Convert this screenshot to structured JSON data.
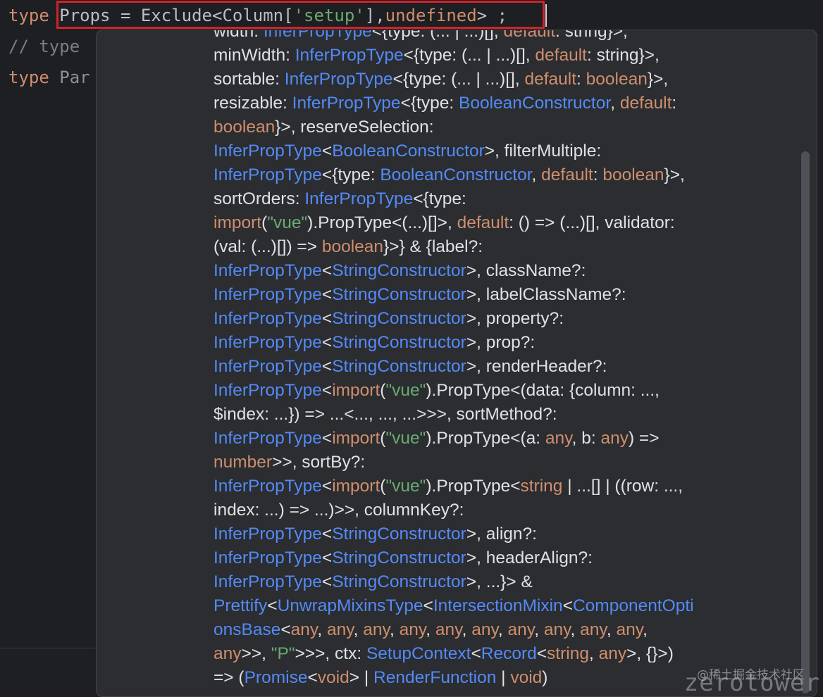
{
  "editor": {
    "line1": {
      "kw": "type",
      "rest_a": "Props = Exclude<Column[",
      "str": "'setup'",
      "rest_b": "],",
      "kw2": "undefined",
      "rest_c": "> ;"
    },
    "line2": {
      "comment": "// type"
    },
    "line3": {
      "kw": "type",
      "rest": "Par"
    }
  },
  "popup": {
    "lines": [
      [
        [
          "t",
          "width: "
        ],
        [
          "ty",
          "InferPropType"
        ],
        [
          "t",
          "<{type: (... | ...)[], "
        ],
        [
          "or",
          "default"
        ],
        [
          "t",
          ": string}>,"
        ]
      ],
      [
        [
          "t",
          "minWidth: "
        ],
        [
          "ty",
          "InferPropType"
        ],
        [
          "t",
          "<{type: (... | ...)[], "
        ],
        [
          "or",
          "default"
        ],
        [
          "t",
          ": string}>,"
        ]
      ],
      [
        [
          "t",
          "sortable: "
        ],
        [
          "ty",
          "InferPropType"
        ],
        [
          "t",
          "<{type: (... | ...)[], "
        ],
        [
          "or",
          "default"
        ],
        [
          "t",
          ": "
        ],
        [
          "or",
          "boolean"
        ],
        [
          "t",
          "}>,"
        ]
      ],
      [
        [
          "t",
          "resizable: "
        ],
        [
          "ty",
          "InferPropType"
        ],
        [
          "t",
          "<{type: "
        ],
        [
          "ty",
          "BooleanConstructor"
        ],
        [
          "t",
          ", "
        ],
        [
          "or",
          "default"
        ],
        [
          "t",
          ":"
        ]
      ],
      [
        [
          "or",
          "boolean"
        ],
        [
          "t",
          "}>, reserveSelection:"
        ]
      ],
      [
        [
          "ty",
          "InferPropType"
        ],
        [
          "t",
          "<"
        ],
        [
          "ty",
          "BooleanConstructor"
        ],
        [
          "t",
          ">, filterMultiple:"
        ]
      ],
      [
        [
          "ty",
          "InferPropType"
        ],
        [
          "t",
          "<{type: "
        ],
        [
          "ty",
          "BooleanConstructor"
        ],
        [
          "t",
          ", "
        ],
        [
          "or",
          "default"
        ],
        [
          "t",
          ": "
        ],
        [
          "or",
          "boolean"
        ],
        [
          "t",
          "}>,"
        ]
      ],
      [
        [
          "t",
          "sortOrders: "
        ],
        [
          "ty",
          "InferPropType"
        ],
        [
          "t",
          "<{type:"
        ]
      ],
      [
        [
          "or",
          "import"
        ],
        [
          "t",
          "("
        ],
        [
          "gr",
          "\"vue\""
        ],
        [
          "t",
          ").PropType<(...)[]>, "
        ],
        [
          "or",
          "default"
        ],
        [
          "t",
          ": () => (...)[], validator:"
        ]
      ],
      [
        [
          "t",
          "(val: (...)[]) => "
        ],
        [
          "or",
          "boolean"
        ],
        [
          "t",
          "}>} & {label?:"
        ]
      ],
      [
        [
          "ty",
          "InferPropType"
        ],
        [
          "t",
          "<"
        ],
        [
          "ty",
          "StringConstructor"
        ],
        [
          "t",
          ">, className?:"
        ]
      ],
      [
        [
          "ty",
          "InferPropType"
        ],
        [
          "t",
          "<"
        ],
        [
          "ty",
          "StringConstructor"
        ],
        [
          "t",
          ">, labelClassName?:"
        ]
      ],
      [
        [
          "ty",
          "InferPropType"
        ],
        [
          "t",
          "<"
        ],
        [
          "ty",
          "StringConstructor"
        ],
        [
          "t",
          ">, property?:"
        ]
      ],
      [
        [
          "ty",
          "InferPropType"
        ],
        [
          "t",
          "<"
        ],
        [
          "ty",
          "StringConstructor"
        ],
        [
          "t",
          ">, prop?:"
        ]
      ],
      [
        [
          "ty",
          "InferPropType"
        ],
        [
          "t",
          "<"
        ],
        [
          "ty",
          "StringConstructor"
        ],
        [
          "t",
          ">, renderHeader?:"
        ]
      ],
      [
        [
          "ty",
          "InferPropType"
        ],
        [
          "t",
          "<"
        ],
        [
          "or",
          "import"
        ],
        [
          "t",
          "("
        ],
        [
          "gr",
          "\"vue\""
        ],
        [
          "t",
          ").PropType<(data: {column: ...,"
        ]
      ],
      [
        [
          "t",
          "$index: ...}) => ...<..., ..., ...>>>, sortMethod?:"
        ]
      ],
      [
        [
          "ty",
          "InferPropType"
        ],
        [
          "t",
          "<"
        ],
        [
          "or",
          "import"
        ],
        [
          "t",
          "("
        ],
        [
          "gr",
          "\"vue\""
        ],
        [
          "t",
          ").PropType<(a: "
        ],
        [
          "or",
          "any"
        ],
        [
          "t",
          ", b: "
        ],
        [
          "or",
          "any"
        ],
        [
          "t",
          ") =>"
        ]
      ],
      [
        [
          "or",
          "number"
        ],
        [
          "t",
          ">>, sortBy?:"
        ]
      ],
      [
        [
          "ty",
          "InferPropType"
        ],
        [
          "t",
          "<"
        ],
        [
          "or",
          "import"
        ],
        [
          "t",
          "("
        ],
        [
          "gr",
          "\"vue\""
        ],
        [
          "t",
          ").PropType<"
        ],
        [
          "or",
          "string"
        ],
        [
          "t",
          " | ...[] | ((row: ...,"
        ]
      ],
      [
        [
          "t",
          "index: ...) => ...)>>, columnKey?:"
        ]
      ],
      [
        [
          "ty",
          "InferPropType"
        ],
        [
          "t",
          "<"
        ],
        [
          "ty",
          "StringConstructor"
        ],
        [
          "t",
          ">, align?:"
        ]
      ],
      [
        [
          "ty",
          "InferPropType"
        ],
        [
          "t",
          "<"
        ],
        [
          "ty",
          "StringConstructor"
        ],
        [
          "t",
          ">, headerAlign?:"
        ]
      ],
      [
        [
          "ty",
          "InferPropType"
        ],
        [
          "t",
          "<"
        ],
        [
          "ty",
          "StringConstructor"
        ],
        [
          "t",
          ">, ...}> &"
        ]
      ],
      [
        [
          "ty",
          "Prettify"
        ],
        [
          "t",
          "<"
        ],
        [
          "ty",
          "UnwrapMixinsType"
        ],
        [
          "t",
          "<"
        ],
        [
          "ty",
          "IntersectionMixin"
        ],
        [
          "t",
          "<"
        ],
        [
          "ty",
          "ComponentOpti"
        ]
      ],
      [
        [
          "ty",
          "onsBase"
        ],
        [
          "t",
          "<"
        ],
        [
          "or",
          "any"
        ],
        [
          "t",
          ", "
        ],
        [
          "or",
          "any"
        ],
        [
          "t",
          ", "
        ],
        [
          "or",
          "any"
        ],
        [
          "t",
          ", "
        ],
        [
          "or",
          "any"
        ],
        [
          "t",
          ", "
        ],
        [
          "or",
          "any"
        ],
        [
          "t",
          ", "
        ],
        [
          "or",
          "any"
        ],
        [
          "t",
          ", "
        ],
        [
          "or",
          "any"
        ],
        [
          "t",
          ", "
        ],
        [
          "or",
          "any"
        ],
        [
          "t",
          ", "
        ],
        [
          "or",
          "any"
        ],
        [
          "t",
          ", "
        ],
        [
          "or",
          "any"
        ],
        [
          "t",
          ","
        ]
      ],
      [
        [
          "or",
          "any"
        ],
        [
          "t",
          ">>, "
        ],
        [
          "gr",
          "\"P\""
        ],
        [
          "t",
          ">>>, ctx: "
        ],
        [
          "ty",
          "SetupContext"
        ],
        [
          "t",
          "<"
        ],
        [
          "ty",
          "Record"
        ],
        [
          "t",
          "<"
        ],
        [
          "or",
          "string"
        ],
        [
          "t",
          ", "
        ],
        [
          "or",
          "any"
        ],
        [
          "t",
          ">, {}>)"
        ]
      ],
      [
        [
          "t",
          "=> ("
        ],
        [
          "ty",
          "Promise"
        ],
        [
          "t",
          "<"
        ],
        [
          "or",
          "void"
        ],
        [
          "t",
          "> | "
        ],
        [
          "ty",
          "RenderFunction"
        ],
        [
          "t",
          " | "
        ],
        [
          "or",
          "void"
        ],
        [
          "t",
          ")"
        ]
      ]
    ]
  },
  "watermark": {
    "text": "@稀土掘金技术社区",
    "logo": "zerotower"
  }
}
